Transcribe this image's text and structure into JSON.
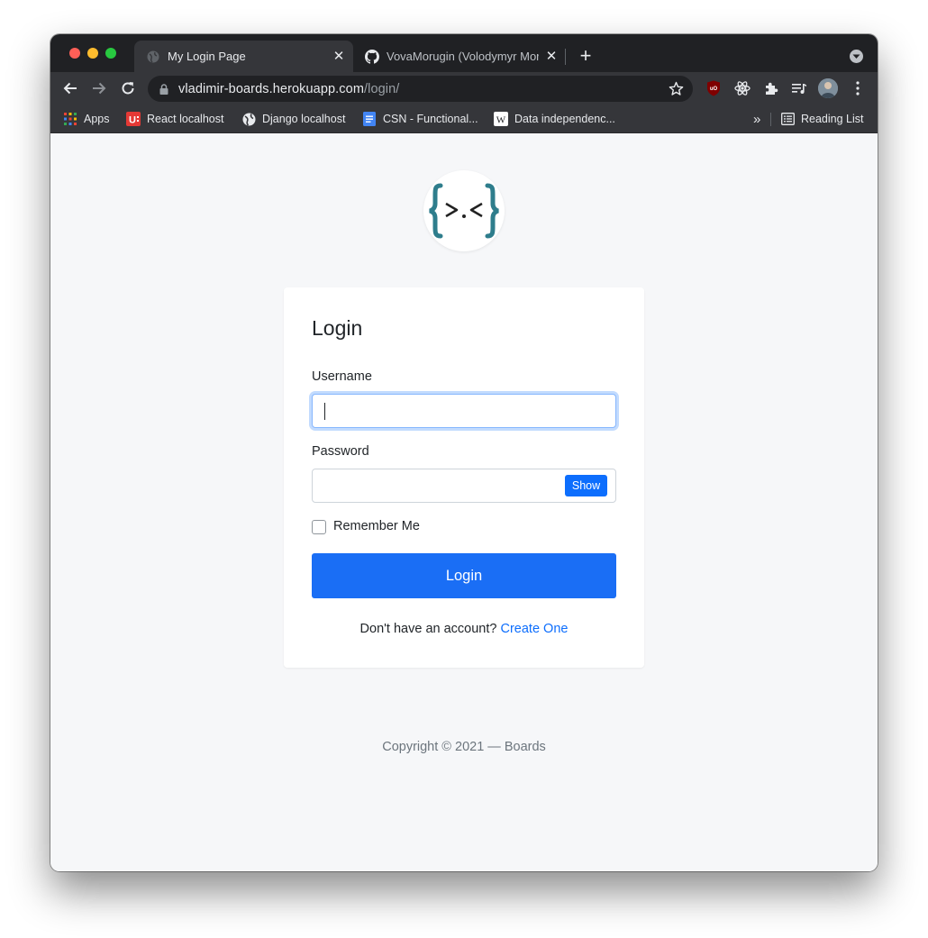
{
  "browser": {
    "tabs": [
      {
        "title": "My Login Page",
        "active": true
      },
      {
        "title": "VovaMorugin (Volodymyr Morugin)",
        "active": false
      }
    ],
    "address": {
      "host": "vladimir-boards.herokuapp.com",
      "path": "/login/"
    },
    "bookmarks": [
      {
        "label": "Apps"
      },
      {
        "label": "React localhost"
      },
      {
        "label": "Django localhost"
      },
      {
        "label": "CSN - Functional..."
      },
      {
        "label": "Data independenc..."
      }
    ],
    "overflow_label": "»",
    "reading_list": "Reading List"
  },
  "site": {
    "logo_text": "{>.<}",
    "logo_color": "#2e7d8c"
  },
  "login_form": {
    "title": "Login",
    "username_label": "Username",
    "username_value": "",
    "password_label": "Password",
    "password_value": "",
    "show_button": "Show",
    "remember_label": "Remember Me",
    "remember_checked": false,
    "submit_label": "Login",
    "signup_prompt": "Don't have an account?",
    "signup_link": "Create One"
  },
  "footer": {
    "text": "Copyright © 2021 — Boards"
  },
  "colors": {
    "primary": "#0d6efd",
    "chrome_dark": "#202124",
    "chrome_toolbar": "#35363a",
    "page_bg": "#f6f7f9"
  }
}
